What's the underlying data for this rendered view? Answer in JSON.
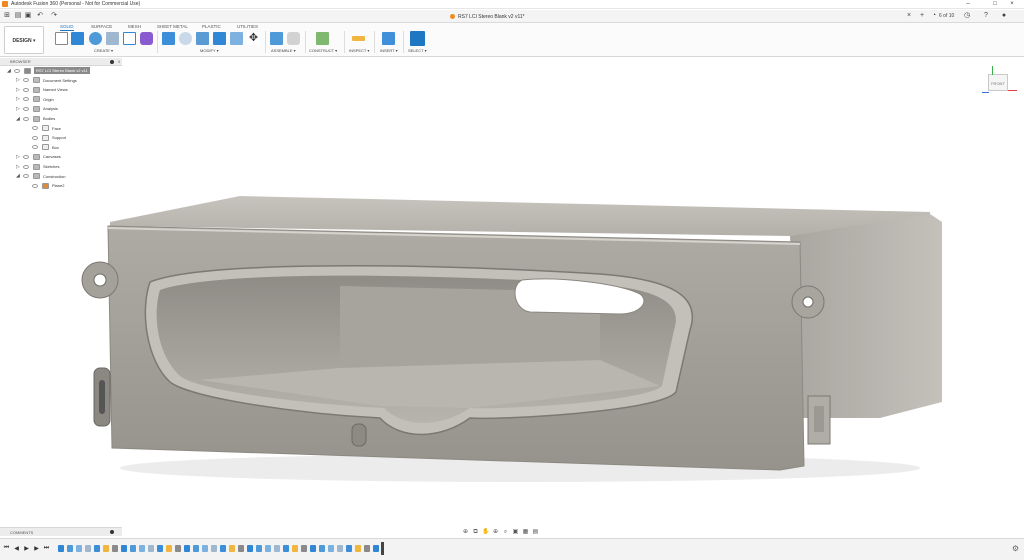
{
  "window": {
    "title": "Autodesk Fusion 360 (Personal - Not for Commercial Use)",
    "controls": [
      "–",
      "□",
      "×"
    ]
  },
  "document": {
    "tab_title": "RS7 LCI Stereo Blank v2 v11*",
    "job_status": "6 of 10"
  },
  "workspace": {
    "label": "DESIGN ▾"
  },
  "ribbon": {
    "tabs": [
      "SOLID",
      "SURFACE",
      "MESH",
      "SHEET METAL",
      "PLASTIC",
      "UTILITIES"
    ],
    "active_tab": "SOLID",
    "groups": [
      "CREATE ▾",
      "MODIFY ▾",
      "ASSEMBLE ▾",
      "CONSTRUCT ▾",
      "INSPECT ▾",
      "INSERT ▾",
      "SELECT ▾"
    ]
  },
  "browser": {
    "title": "BROWSER",
    "items": [
      {
        "label": "RS7 LCI Stereo Blank v2 v11",
        "level": 0,
        "icon": "component-icon",
        "expanded": true,
        "root": true
      },
      {
        "label": "Document Settings",
        "level": 1,
        "icon": "gear-icon",
        "expanded": false
      },
      {
        "label": "Named Views",
        "level": 1,
        "icon": "folder-icon",
        "expanded": false
      },
      {
        "label": "Origin",
        "level": 1,
        "icon": "folder-icon",
        "expanded": false
      },
      {
        "label": "Analysis",
        "level": 1,
        "icon": "folder-icon",
        "expanded": false
      },
      {
        "label": "Bodies",
        "level": 1,
        "icon": "folder-icon",
        "expanded": true
      },
      {
        "label": "Face",
        "level": 2,
        "icon": "body-icon"
      },
      {
        "label": "Support",
        "level": 2,
        "icon": "body-icon"
      },
      {
        "label": "Box",
        "level": 2,
        "icon": "body-icon"
      },
      {
        "label": "Canvases",
        "level": 1,
        "icon": "folder-icon",
        "expanded": false
      },
      {
        "label": "Sketches",
        "level": 1,
        "icon": "folder-icon",
        "expanded": false
      },
      {
        "label": "Construction",
        "level": 1,
        "icon": "folder-icon",
        "expanded": true
      },
      {
        "label": "Plane2",
        "level": 2,
        "icon": "plane-icon"
      }
    ]
  },
  "viewcube": {
    "front_label": "FRONT",
    "side_label": "RIGHT"
  },
  "comments": {
    "title": "COMMENTS"
  },
  "colors": {
    "accent": "#1f76c2",
    "app_orange": "#f08a1e",
    "model_face": "#a19e97",
    "model_light": "#bebbb4",
    "model_dark": "#6f6c66"
  }
}
